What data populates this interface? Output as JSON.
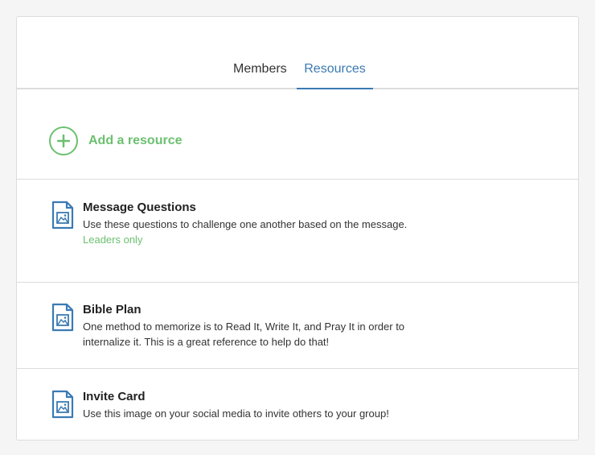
{
  "tabs": {
    "members_label": "Members",
    "resources_label": "Resources",
    "active": "Resources"
  },
  "add_resource": {
    "label": "Add a resource"
  },
  "resources": [
    {
      "title": "Message Questions",
      "description": "Use these questions to challenge one another based on the message.",
      "tag": "Leaders only",
      "icon": "document-image-icon"
    },
    {
      "title": "Bible Plan",
      "description": "One method to memorize is to Read It, Write It, and Pray It in order to internalize it. This is a great reference to help do that!",
      "icon": "document-image-icon"
    },
    {
      "title": "Invite Card",
      "description": "Use this image on your social media to invite others to your group!",
      "icon": "document-image-icon"
    }
  ],
  "colors": {
    "accent_blue": "#3a7ab3",
    "accent_green": "#6cc070",
    "border": "#dcdcdc"
  }
}
